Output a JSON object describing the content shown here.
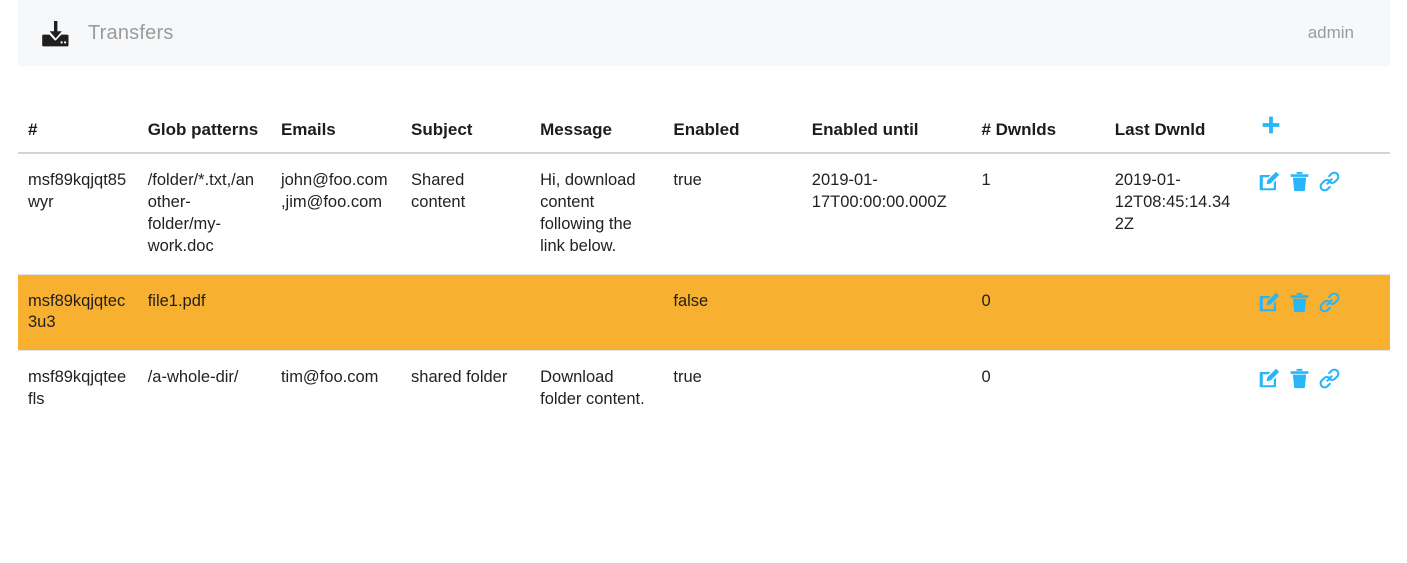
{
  "navbar": {
    "brand_icon": "download-tray-icon",
    "title": "Transfers",
    "user": "admin"
  },
  "colors": {
    "accent_blue": "#29b6f6",
    "highlight_orange": "#f8b030",
    "navbar_bg": "#f7f8fa",
    "header_text": "#1c1c1c",
    "muted_text": "#9b9b9b"
  },
  "table": {
    "columns": [
      {
        "key": "id",
        "label": "#"
      },
      {
        "key": "glob",
        "label": "Glob patterns"
      },
      {
        "key": "emails",
        "label": "Emails"
      },
      {
        "key": "subject",
        "label": "Subject"
      },
      {
        "key": "message",
        "label": "Message"
      },
      {
        "key": "enabled",
        "label": "Enabled"
      },
      {
        "key": "until",
        "label": "Enabled until"
      },
      {
        "key": "dwnlds",
        "label": "# Dwnlds"
      },
      {
        "key": "last",
        "label": "Last Dwnld"
      },
      {
        "key": "actions",
        "label": "+"
      }
    ],
    "add_icon": "plus-icon",
    "row_actions": [
      {
        "name": "edit-icon",
        "title": "Edit"
      },
      {
        "name": "delete-icon",
        "title": "Delete"
      },
      {
        "name": "link-icon",
        "title": "Link"
      }
    ],
    "rows": [
      {
        "id": "msf89kqjqt85wyr",
        "glob": "/folder/*.txt,/another-folder/my-work.doc",
        "emails": "john@foo.com,jim@foo.com",
        "subject": "Shared content",
        "message": "Hi, download content following the link below.",
        "enabled": "true",
        "until": "2019-01-17T00:00:00.000Z",
        "dwnlds": "1",
        "last": "2019-01-12T08:45:14.342Z",
        "highlighted": false
      },
      {
        "id": "msf89kqjqtec3u3",
        "glob": "file1.pdf",
        "emails": "",
        "subject": "",
        "message": "",
        "enabled": "false",
        "until": "",
        "dwnlds": "0",
        "last": "",
        "highlighted": true
      },
      {
        "id": "msf89kqjqteefls",
        "glob": "/a-whole-dir/",
        "emails": "tim@foo.com",
        "subject": "shared folder",
        "message": "Download folder content.",
        "enabled": "true",
        "until": "",
        "dwnlds": "0",
        "last": "",
        "highlighted": false
      }
    ]
  }
}
